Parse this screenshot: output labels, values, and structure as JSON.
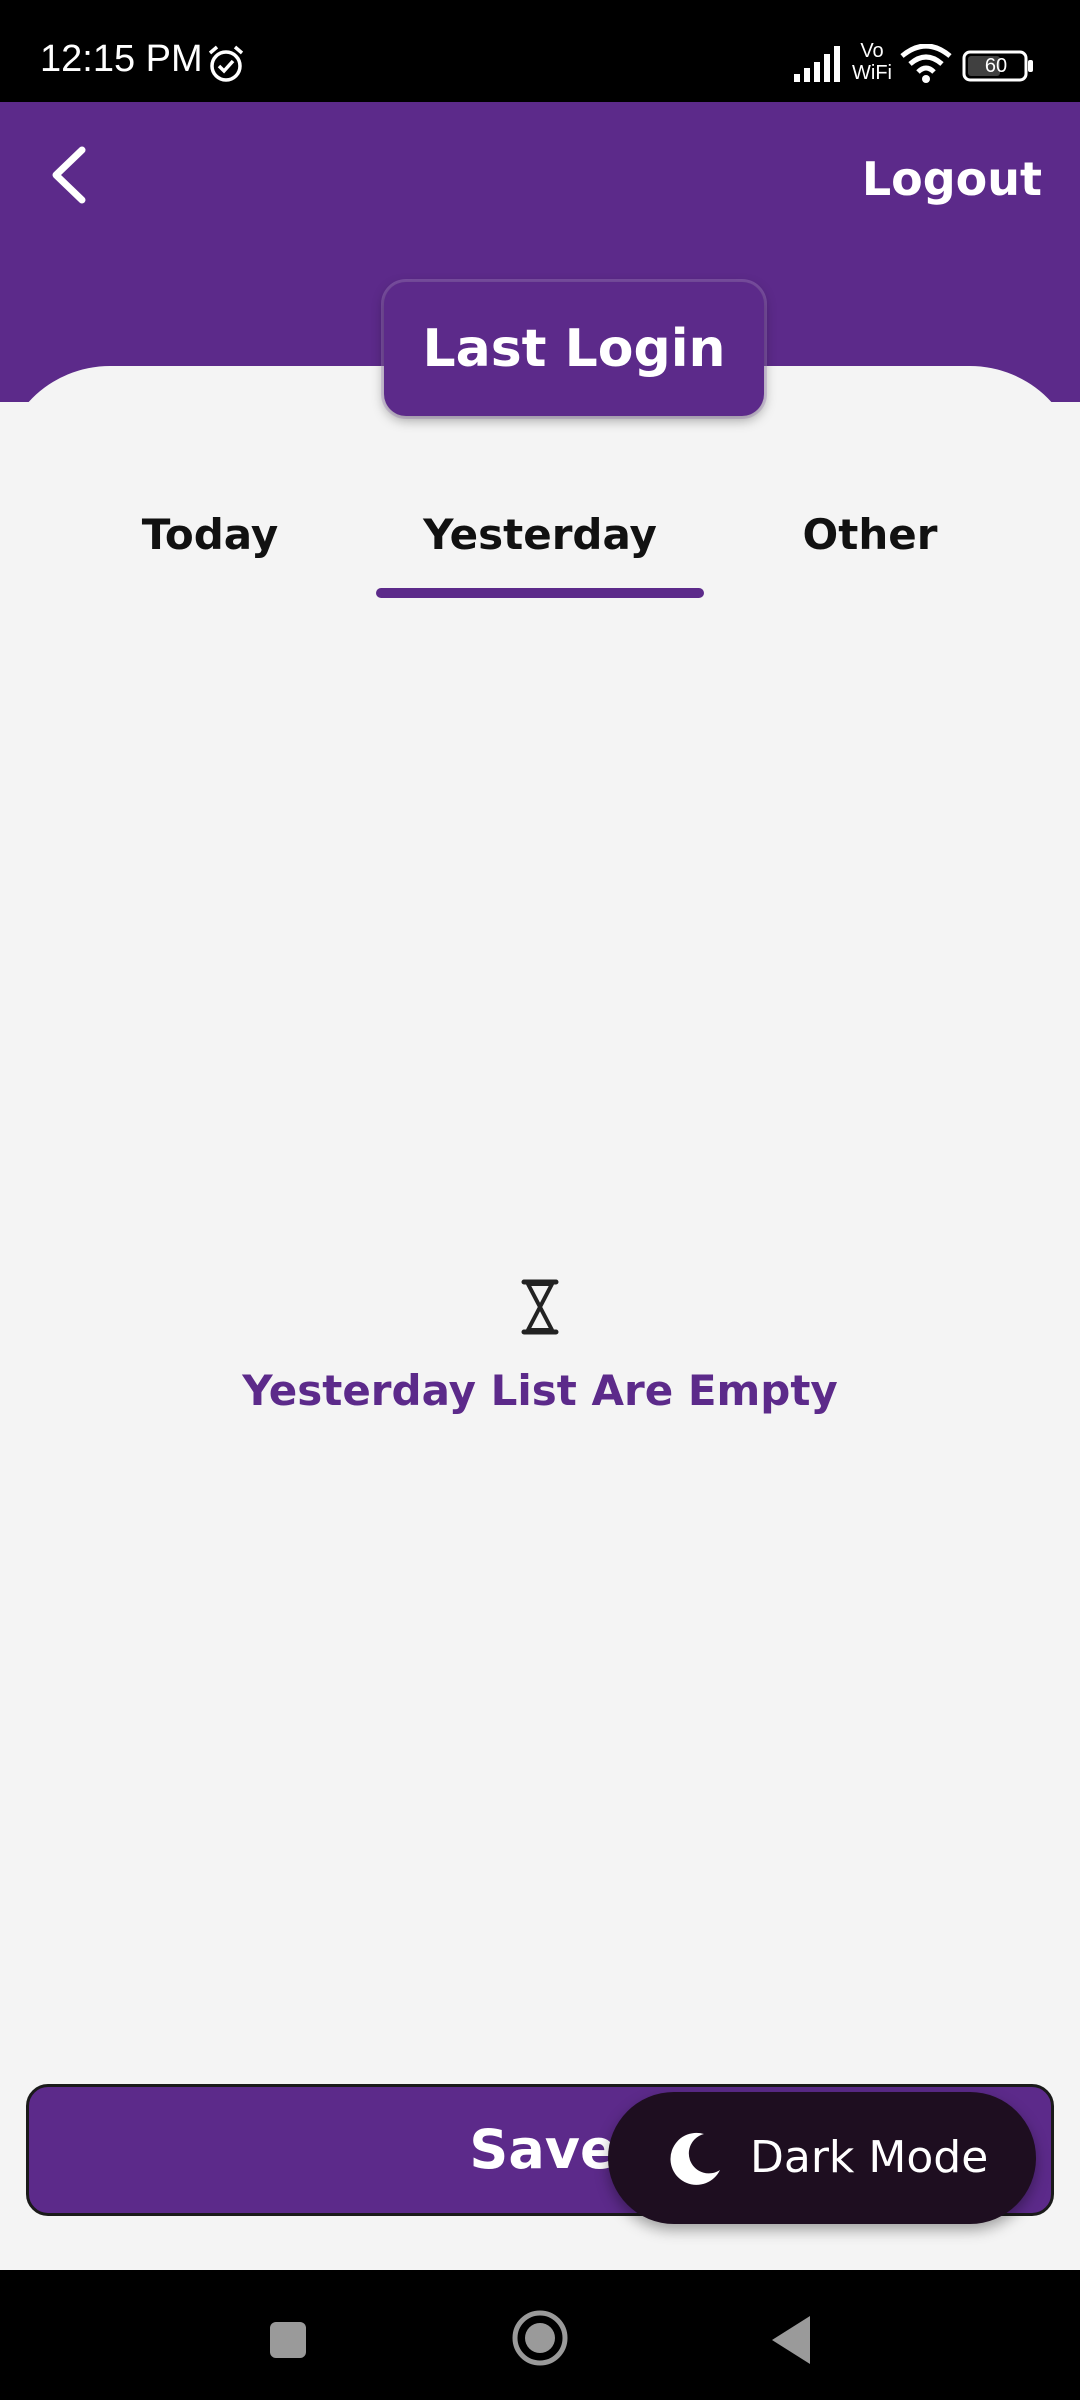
{
  "status_bar": {
    "time": "12:15 PM",
    "network_label": "Vo\nWiFi",
    "battery_level": "60"
  },
  "header": {
    "logout_label": "Logout",
    "title": "Last Login"
  },
  "tabs": [
    {
      "label": "Today",
      "selected": false
    },
    {
      "label": "Yesterday",
      "selected": true
    },
    {
      "label": "Other",
      "selected": false
    }
  ],
  "empty_state": {
    "icon": "hourglass-icon",
    "message": "Yesterday List Are Empty"
  },
  "save_label": "Save",
  "dark_mode": {
    "icon": "moon-icon",
    "label": "Dark Mode"
  },
  "colors": {
    "primary": "#5c2a8a",
    "dark_pill": "#1e0e20",
    "background": "#f4f4f4"
  }
}
